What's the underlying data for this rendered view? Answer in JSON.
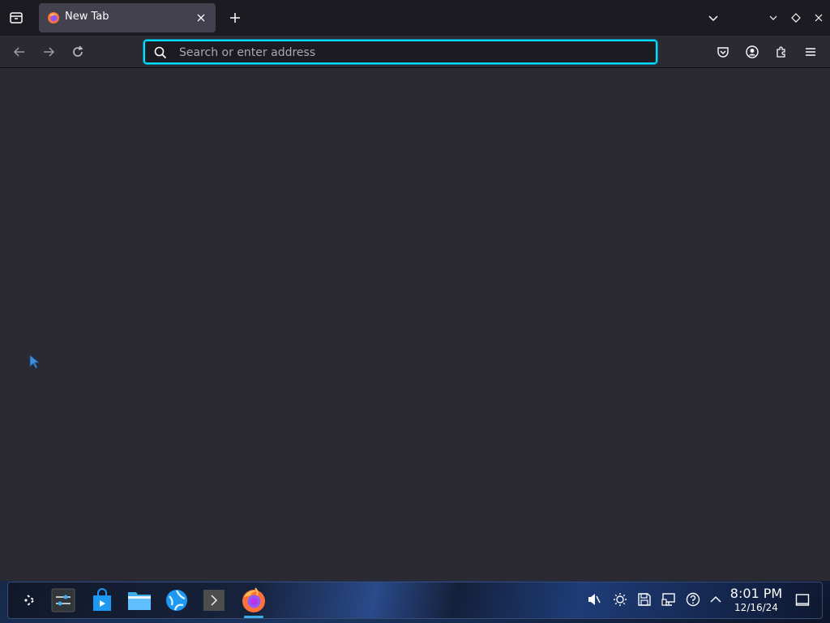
{
  "browser": {
    "tab": {
      "title": "New Tab"
    },
    "urlbar": {
      "placeholder": "Search or enter address",
      "value": ""
    },
    "accent_color": "#00ddff"
  },
  "taskbar": {
    "apps": [
      "launcher-icon",
      "system-settings-icon",
      "software-store-icon",
      "file-manager-icon",
      "web-browser-icon",
      "terminal-icon",
      "firefox-icon"
    ],
    "tray": [
      "volume-muted-icon",
      "brightness-icon",
      "disk-icon",
      "network-icon",
      "help-icon",
      "expand-tray-icon"
    ],
    "clock": {
      "time": "8:01 PM",
      "date": "12/16/24"
    }
  }
}
